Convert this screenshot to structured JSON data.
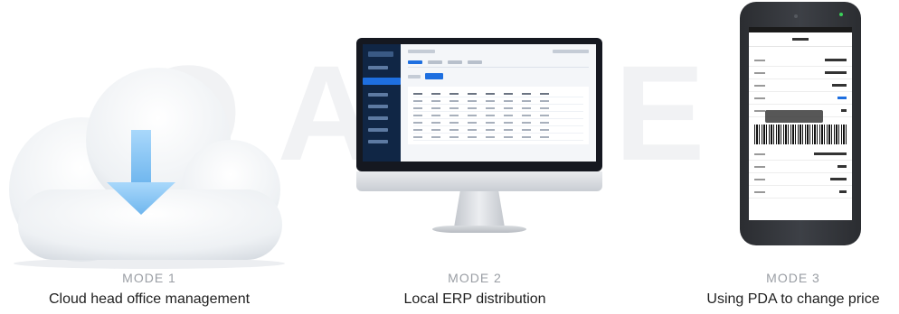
{
  "modes": [
    {
      "label": "MODE 1",
      "description": "Cloud head office management"
    },
    {
      "label": "MODE 2",
      "description": "Local ERP distribution"
    },
    {
      "label": "MODE 3",
      "description": "Using PDA to change price"
    }
  ],
  "icons": {
    "mode1": "cloud-download-icon",
    "mode2": "desktop-monitor-icon",
    "mode3": "pda-handheld-icon"
  },
  "colors": {
    "accent": "#1e6fe0",
    "arrow": "#8cc8f5",
    "mode_label": "#9a9ea4",
    "description": "#1f1f1f"
  }
}
